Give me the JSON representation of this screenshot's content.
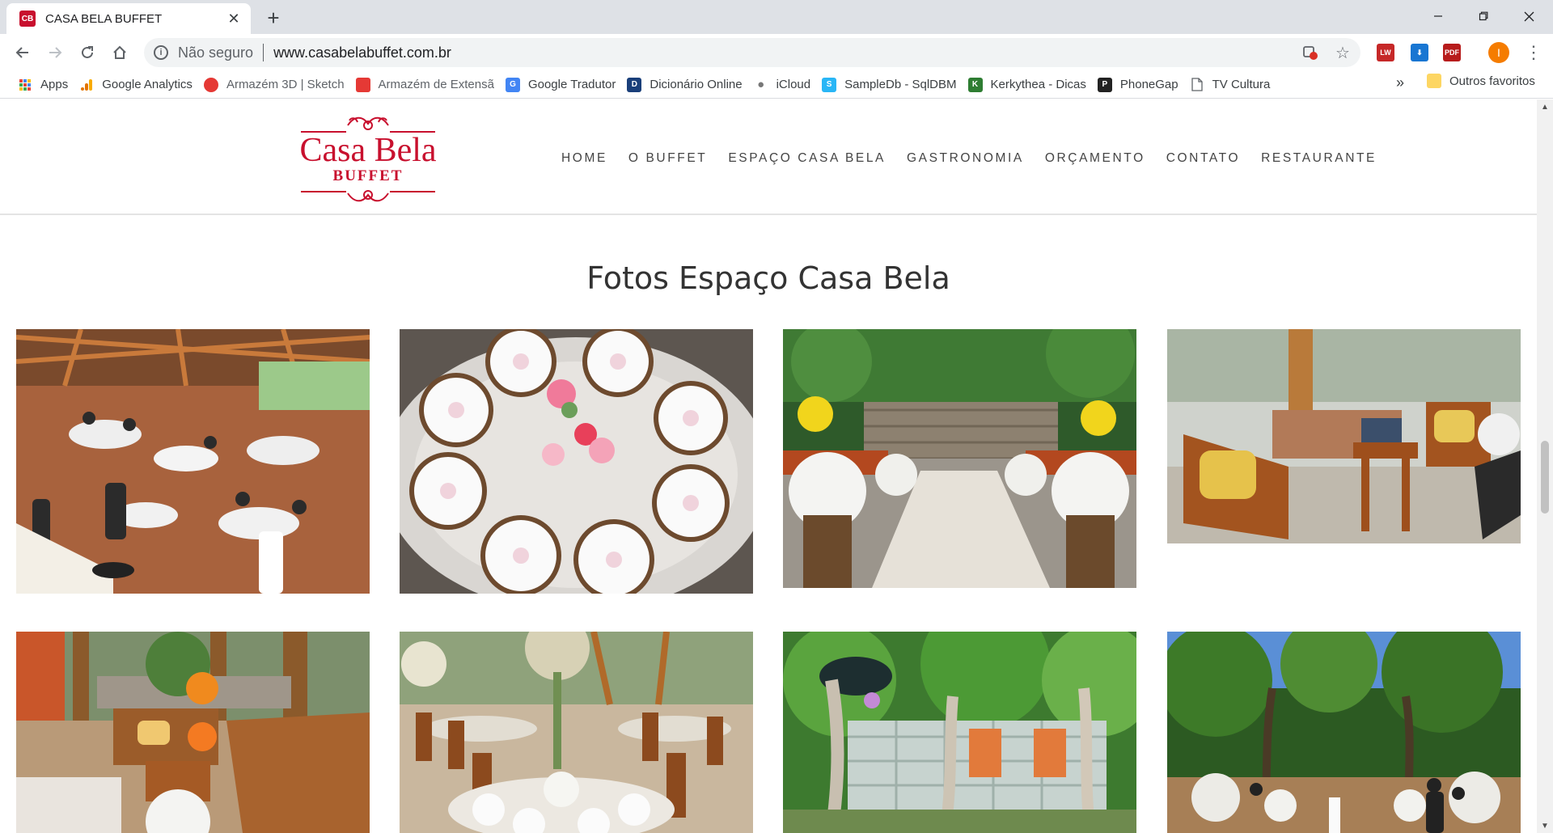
{
  "browser": {
    "tab": {
      "favicon_text": "CB",
      "title": "CASA BELA BUFFET"
    },
    "omnibox": {
      "security_label": "Não seguro",
      "url": "www.casabelabuffet.com.br"
    },
    "profile_initial": "I",
    "bookmarks": [
      {
        "label": "Apps",
        "icon": "apps-grid-icon",
        "color": "#4285f4"
      },
      {
        "label": "Google Analytics",
        "icon": "analytics-icon",
        "color": "#f9ab00"
      },
      {
        "label": "Armazém 3D | Sketch",
        "icon": "sketchup-icon",
        "color": "#e53935"
      },
      {
        "label": "Armazém de Extensã",
        "icon": "sketchup-icon",
        "color": "#e53935"
      },
      {
        "label": "Google Tradutor",
        "icon": "translate-icon",
        "color": "#4285f4"
      },
      {
        "label": "Dicionário Online",
        "icon": "dictionary-icon",
        "color": "#1a3f7a"
      },
      {
        "label": "iCloud",
        "icon": "apple-icon",
        "color": "#777777"
      },
      {
        "label": "SampleDb - SqlDBM",
        "icon": "database-icon",
        "color": "#29b6f6"
      },
      {
        "label": "Kerkythea - Dicas",
        "icon": "kerkythea-icon",
        "color": "#2e7d32"
      },
      {
        "label": "PhoneGap",
        "icon": "phonegap-icon",
        "color": "#222222"
      },
      {
        "label": "TV Cultura",
        "icon": "page-icon",
        "color": "#ffffff"
      }
    ],
    "bookmarks_overflow": "»",
    "other_bookmarks": "Outros favoritos"
  },
  "site": {
    "logo": {
      "line1": "Casa Bela",
      "line2": "BUFFET",
      "color": "#c8102e"
    },
    "nav": [
      "HOME",
      "O BUFFET",
      "ESPAÇO CASA BELA",
      "GASTRONOMIA",
      "ORÇAMENTO",
      "CONTATO",
      "RESTAURANTE"
    ],
    "section_title": "Fotos Espaço Casa Bela",
    "photos": [
      "banquet-hall-guests-photo",
      "table-setting-plates-photo",
      "garden-ceremony-aisle-photo",
      "wooden-bench-lounge-photo",
      "veranda-lounge-flowers-photo",
      "dining-hall-tables-photo",
      "glass-pavilion-trees-photo",
      "forest-ceremony-photo"
    ]
  }
}
